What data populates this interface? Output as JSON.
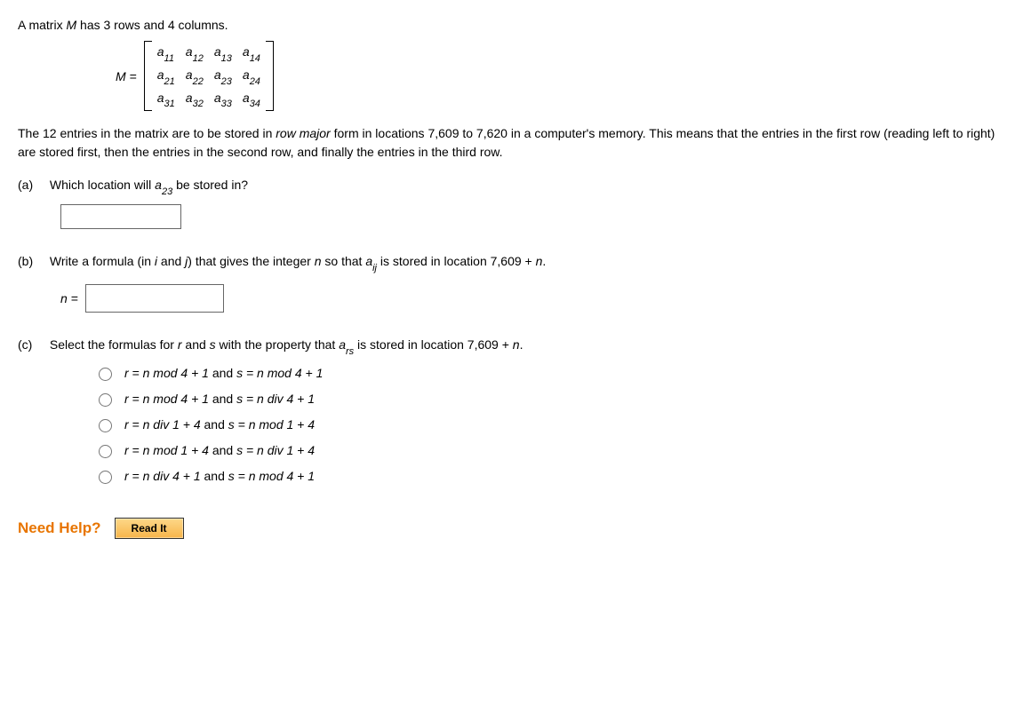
{
  "intro": {
    "prefix": "A matrix ",
    "var": "M",
    "suffix": " has 3 rows and 4 columns."
  },
  "matrix": {
    "label_var": "M",
    "label_eq": " = ",
    "cells": [
      [
        "11",
        "12",
        "13",
        "14"
      ],
      [
        "21",
        "22",
        "23",
        "24"
      ],
      [
        "31",
        "32",
        "33",
        "34"
      ]
    ],
    "entry_var": "a"
  },
  "para": {
    "t1": "The 12 entries in the matrix are to be stored in ",
    "em1": "row major",
    "t2": " form in locations 7,609 to 7,620 in a computer's memory. This means that the entries in the first row (reading left to right) are stored first, then the entries in the second row, and finally the entries in the third row."
  },
  "a": {
    "label": "(a)",
    "q1": "Which location will ",
    "var": "a",
    "sub": "23",
    "q2": " be stored in?"
  },
  "b": {
    "label": "(b)",
    "q1": "Write a formula (in ",
    "i": "i",
    "q2": " and ",
    "j": "j",
    "q3": ") that gives the integer ",
    "n": "n",
    "q4": " so that ",
    "var": "a",
    "sub": "ij",
    "q5": " is stored in location 7,609 + ",
    "n2": "n",
    "q6": ".",
    "n_eq": "n ="
  },
  "c": {
    "label": "(c)",
    "q1": "Select the formulas for ",
    "r": "r",
    "q2": " and ",
    "s": "s",
    "q3": " with the property that ",
    "var": "a",
    "sub": "rs",
    "q4": " is stored in location 7,609 + ",
    "n": "n",
    "q5": ".",
    "options": [
      {
        "r": "r = n mod 4 + 1",
        "s": "s = n mod 4 + 1"
      },
      {
        "r": "r = n mod 4 + 1",
        "s": "s = n div 4 + 1"
      },
      {
        "r": "r = n div 1 + 4",
        "s": "s = n mod 1 + 4"
      },
      {
        "r": "r = n mod 1 + 4",
        "s": "s = n div 1 + 4"
      },
      {
        "r": "r = n div 4 + 1",
        "s": "s = n mod 4 + 1"
      }
    ]
  },
  "help": {
    "label": "Need Help?",
    "read_it": "Read It"
  }
}
